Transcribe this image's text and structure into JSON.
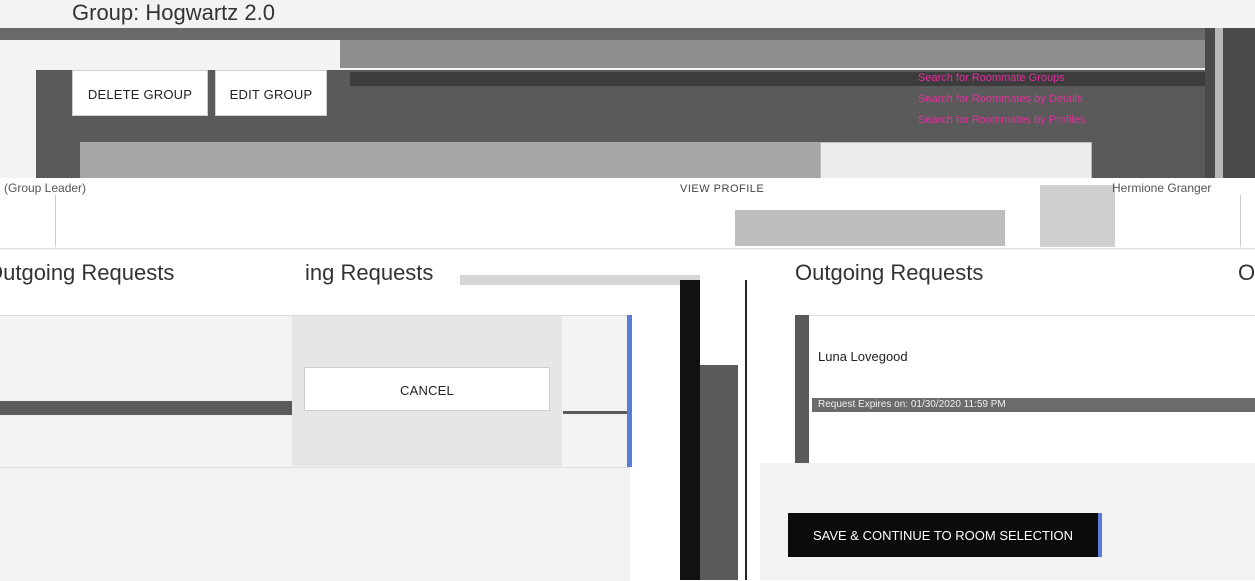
{
  "group": {
    "title": "Group: Hogwartz 2.0",
    "delete_label": "DELETE GROUP",
    "edit_label": "EDIT GROUP",
    "links": [
      "Search for Roommate Groups",
      "Search for Roommates by Details",
      "Search for Roommates by Profiles"
    ]
  },
  "members": {
    "leader_label": "(Group Leader)",
    "view_profile_label": "VIEW PROFILE",
    "second_member": "Hermione Granger"
  },
  "sections": {
    "outgoing_header": "Outgoing Requests",
    "incoming_header_left": "ing Requests",
    "outgoing_header_right": "Outgoing Requests",
    "right_edge_header": "O"
  },
  "left_table": {
    "cancel_label": "CANCEL"
  },
  "right_card": {
    "name": "Luna Lovegood",
    "detail": "Request Expires on: 01/30/2020 11:59 PM"
  },
  "footer": {
    "save_label": "SAVE & CONTINUE TO ROOM SELECTION"
  },
  "colors": {
    "link": "#e0309a",
    "primary_button": "#0b0b0b",
    "accent_edge": "#5a7bd6"
  }
}
